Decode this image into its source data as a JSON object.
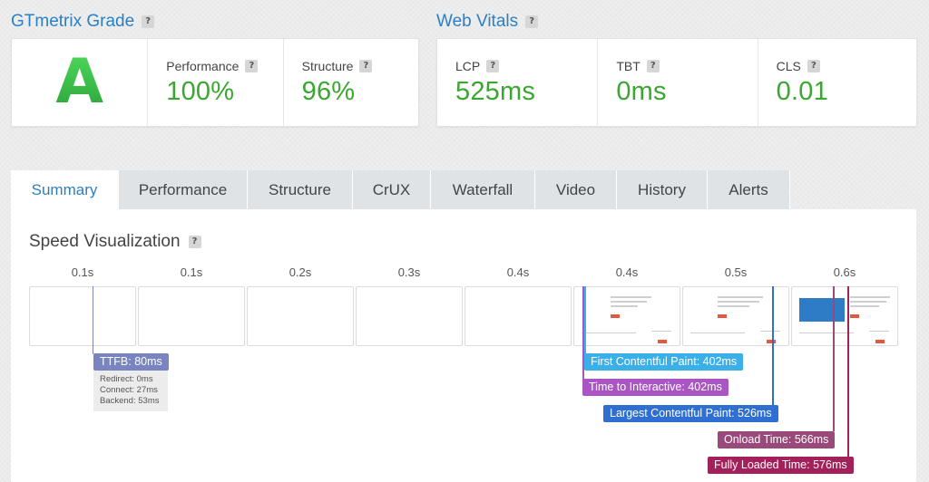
{
  "grade_section": {
    "title": "GTmetrix Grade",
    "grade": "A",
    "performance": {
      "label": "Performance",
      "value": "100%"
    },
    "structure": {
      "label": "Structure",
      "value": "96%"
    }
  },
  "web_vitals": {
    "title": "Web Vitals",
    "lcp": {
      "label": "LCP",
      "value": "525ms"
    },
    "tbt": {
      "label": "TBT",
      "value": "0ms"
    },
    "cls": {
      "label": "CLS",
      "value": "0.01"
    }
  },
  "help_glyph": "?",
  "tabs": [
    {
      "label": "Summary",
      "active": true
    },
    {
      "label": "Performance"
    },
    {
      "label": "Structure"
    },
    {
      "label": "CrUX"
    },
    {
      "label": "Waterfall"
    },
    {
      "label": "Video"
    },
    {
      "label": "History"
    },
    {
      "label": "Alerts"
    }
  ],
  "speed_visualization": {
    "title": "Speed Visualization",
    "frame_times": [
      "0.1s",
      "0.1s",
      "0.2s",
      "0.3s",
      "0.4s",
      "0.4s",
      "0.5s",
      "0.6s"
    ],
    "ttfb": {
      "label": "TTFB: 80ms",
      "redirect": "Redirect: 0ms",
      "connect": "Connect: 27ms",
      "backend": "Backend: 53ms"
    },
    "markers": {
      "fcp": {
        "label": "First Contentful Paint: 402ms",
        "color": "#3bb0e8"
      },
      "tti": {
        "label": "Time to Interactive: 402ms",
        "color": "#a956c4"
      },
      "lcp": {
        "label": "Largest Contentful Paint: 526ms",
        "color": "#2f6fd2"
      },
      "onload": {
        "label": "Onload Time: 566ms",
        "color": "#9a4a7a"
      },
      "fully_loaded": {
        "label": "Fully Loaded Time: 576ms",
        "color": "#a3205a"
      }
    }
  }
}
